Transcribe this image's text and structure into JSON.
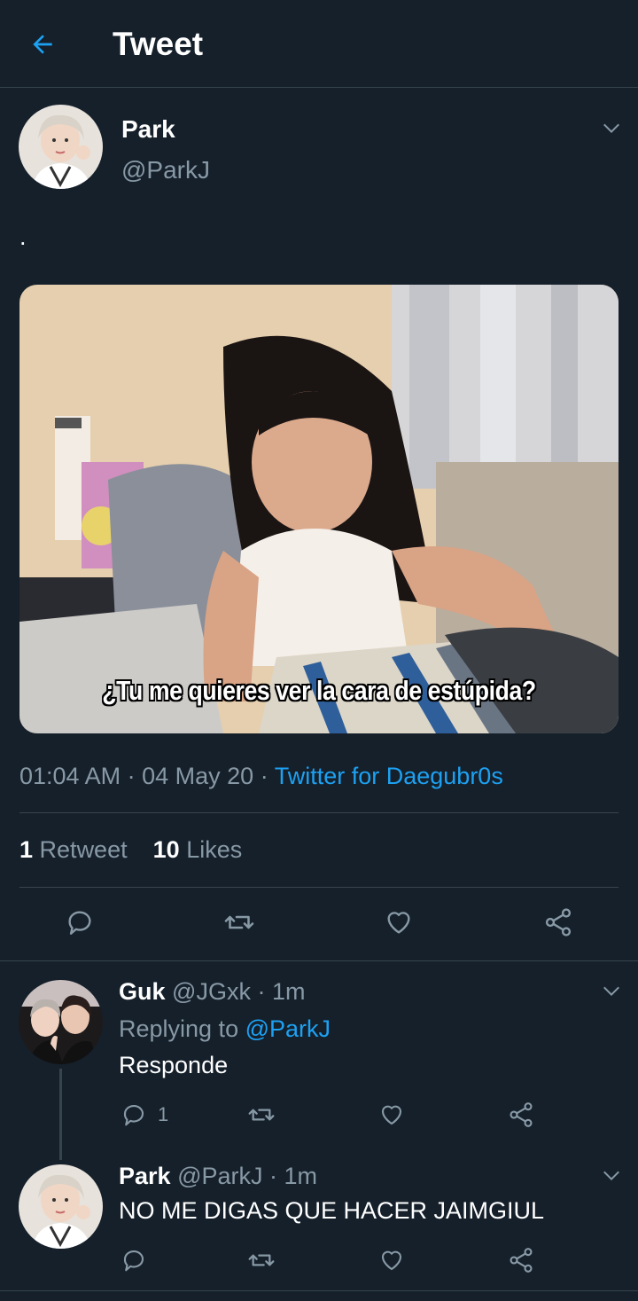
{
  "header": {
    "title": "Tweet"
  },
  "tweet": {
    "name": "Park",
    "handle": "@ParkJ",
    "text": ".",
    "media_caption": "¿Tu me quieres ver la cara de estúpida?",
    "time": "01:04 AM",
    "date": "04 May 20",
    "sep": "·",
    "source": "Twitter for Daegubr0s",
    "retweets_count": "1",
    "retweets_label": "Retweet",
    "likes_count": "10",
    "likes_label": "Likes"
  },
  "replies": [
    {
      "name": "Guk",
      "handle": "@JGxk",
      "time": "· 1m",
      "replying_prefix": "Replying to",
      "replying_to": "@ParkJ",
      "text": "Responde",
      "reply_count": "1"
    },
    {
      "name": "Park",
      "handle": "@ParkJ",
      "time": "· 1m",
      "text": "NO ME DIGAS QUE HACER JAIMGIUL"
    }
  ],
  "icons": {
    "back": "arrow-left-icon",
    "chevron": "chevron-down-icon",
    "reply": "reply-icon",
    "retweet": "retweet-icon",
    "like": "heart-icon",
    "share": "share-icon"
  },
  "colors": {
    "background": "#15202b",
    "accent": "#1da1f2",
    "muted": "#8899a6",
    "divider": "#38444d"
  }
}
